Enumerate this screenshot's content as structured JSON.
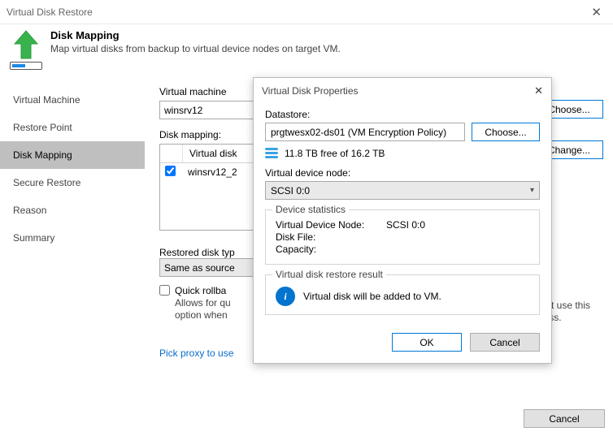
{
  "window": {
    "title": "Virtual Disk Restore",
    "close_glyph": "✕"
  },
  "header": {
    "title": "Disk Mapping",
    "subtitle": "Map virtual disks from backup to virtual device nodes on target VM."
  },
  "sidebar": {
    "items": [
      {
        "label": "Virtual Machine"
      },
      {
        "label": "Restore Point"
      },
      {
        "label": "Disk Mapping"
      },
      {
        "label": "Secure Restore"
      },
      {
        "label": "Reason"
      },
      {
        "label": "Summary"
      }
    ],
    "active_index": 2
  },
  "content": {
    "machine_label": "Virtual machine",
    "machine_value": "winsrv12",
    "choose_btn": "Choose...",
    "disk_mapping_label": "Disk mapping:",
    "grid_header_virtualdisk": "Virtual disk",
    "grid_row0_name": "winsrv12_2",
    "change_btn": "Change...",
    "restored_type_label": "Restored disk typ",
    "restored_type_value": "Same as source",
    "quick_label": "Quick rollba",
    "quick_desc_line1": "Allows for qu",
    "quick_desc_line2": "option when",
    "quick_tail1": "Do not use this",
    "quick_tail2": "ver loss.",
    "proxy_link": "Pick proxy to use"
  },
  "footer": {
    "cancel": "Cancel"
  },
  "modal": {
    "title": "Virtual Disk Properties",
    "close_glyph": "✕",
    "datastore_label": "Datastore:",
    "datastore_value": "prgtwesx02-ds01 (VM Encryption Policy)",
    "choose_btn": "Choose...",
    "free_text": "11.8 TB free of 16.2 TB",
    "vdn_label": "Virtual device node:",
    "vdn_value": "SCSI 0:0",
    "stats_legend": "Device statistics",
    "stats": {
      "k1": "Virtual Device Node:",
      "v1": "SCSI 0:0",
      "k2": "Disk File:",
      "v2": "",
      "k3": "Capacity:",
      "v3": ""
    },
    "result_legend": "Virtual disk restore result",
    "result_text": "Virtual disk will be added to VM.",
    "ok": "OK",
    "cancel": "Cancel"
  }
}
